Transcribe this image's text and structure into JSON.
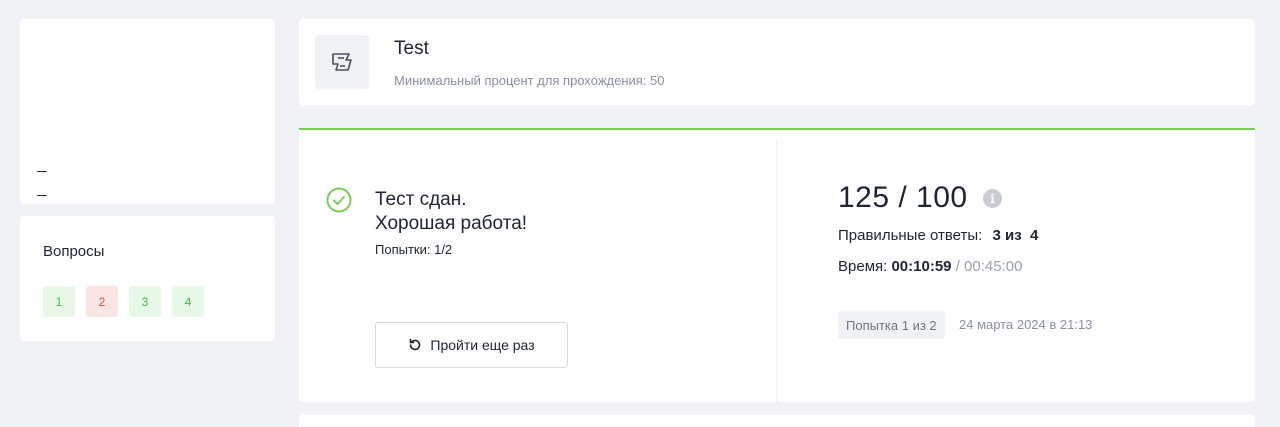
{
  "profile": {
    "line1": "—",
    "line2": "—"
  },
  "questions": {
    "title": "Вопросы",
    "items": [
      {
        "label": "1",
        "status": "correct"
      },
      {
        "label": "2",
        "status": "wrong"
      },
      {
        "label": "3",
        "status": "correct"
      },
      {
        "label": "4",
        "status": "correct"
      }
    ]
  },
  "test": {
    "icon": "certificate-icon",
    "title": "Test",
    "subtitle": "Минимальный процент для прохождения: 50"
  },
  "result": {
    "icon": "check-circle-icon",
    "title_line1": "Тест сдан.",
    "title_line2": "Хорошая работа!",
    "attempts": "Попытки: 1/2",
    "retry_label": "Пройти еще раз",
    "retry_icon": "refresh-icon",
    "score": "125 / 100",
    "info_icon": "info-icon",
    "correct_label": "Правильные ответы:",
    "correct_value": "3 из  4",
    "time_label": "Время:",
    "time_value": "00:10:59",
    "time_limit": "/ 00:45:00",
    "attempt_badge": "Попытка 1 из 2",
    "attempt_date": "24 марта 2024 в 21:13"
  },
  "colors": {
    "accent": "#7ccc5a",
    "correct": "#48b64a",
    "wrong": "#e0504f"
  }
}
